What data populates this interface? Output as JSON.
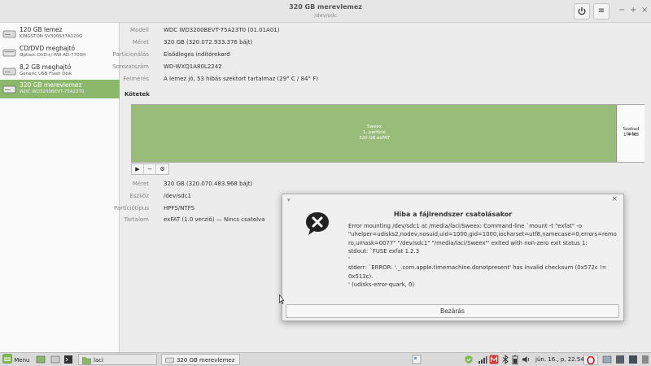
{
  "window": {
    "title": "320 GB merevlemez",
    "subtitle": "/dev/sdc"
  },
  "sidebar": {
    "drives": [
      {
        "name": "120 GB lemez",
        "model": "KINGSTON SV300S37A120G",
        "icon": "hard-disk-icon"
      },
      {
        "name": "CD/DVD meghajtó",
        "model": "Optiarc DVD+/-RW AD-7700H",
        "icon": "optical-drive-icon"
      },
      {
        "name": "8,2 GB meghajtó",
        "model": "Generic USB Flash Disk",
        "icon": "usb-drive-icon"
      },
      {
        "name": "320 GB merevlemez",
        "model": "WDC WD3200BEVT-75A23T0",
        "icon": "hard-disk-icon"
      }
    ]
  },
  "disk": {
    "model_label": "Modell",
    "model": "WDC WD3200BEVT-75A23T0 (01.01A01)",
    "size_label": "Méret",
    "size": "320 GB (320.072.933.376 bájt)",
    "partitioning_label": "Particionálás",
    "partitioning": "Elsődleges indítórekord",
    "serial_label": "Sorozatszám",
    "serial": "WD-WXQ1A80L2242",
    "assessment_label": "Felmérés",
    "assessment": "A lemez jó, 53 hibás szektort tartalmaz (29° C / 84° F)"
  },
  "volumes": {
    "heading": "Kötetek",
    "used": {
      "line1": "Sweex",
      "line2": "1. partíció",
      "line3": "320 GB exFAT",
      "fraction": 0.949
    },
    "free": {
      "line1": "Szabad hely",
      "line2": "1,4 MB"
    },
    "tools": {
      "play": "▶",
      "minus": "−",
      "gear": "⚙"
    }
  },
  "partition": {
    "size_label": "Méret",
    "size": "320 GB (320.070.483.968 bájt)",
    "device_label": "Eszköz",
    "device": "/dev/sdc1",
    "type_label": "Partíciótípus",
    "type": "HPFS/NTFS",
    "content_label": "Tartalom",
    "content": "exFAT (1.0 verzió) — Nincs csatolva"
  },
  "dialog": {
    "title": "Hiba a fájlrendszer csatolásakor",
    "lines": [
      "Error mounting /dev/sdc1 at /media/laci/Sweex: Command-line `mount -t \"exfat\" -o",
      "\"uhelper=udisks2,nodev,nosuid,uid=1000,gid=1000,iocharset=utf8,namecase=0,errors=remount-",
      "ro,umask=0077\" \"/dev/sdc1\" \"/media/laci/Sweex\"' exited with non-zero exit status 1:",
      "stdout: `FUSE exfat 1.2.3",
      "'",
      "stderr: `ERROR: '._.com.apple.timemachine.donotpresent' has invalid checksum (0x572c !=",
      "0x513c).",
      "' (udisks-error-quark, 0)"
    ],
    "button": "Bezárás"
  },
  "taskbar": {
    "menu_label": "Menu",
    "tasks": [
      {
        "label": "laci"
      },
      {
        "label": "320 GB merevlemez"
      }
    ],
    "clock": "jún. 16., p, 22.54"
  },
  "colors": {
    "accent_green": "#8cb86c",
    "volume_green": "#9abc7a",
    "error_icon": "#222222"
  }
}
